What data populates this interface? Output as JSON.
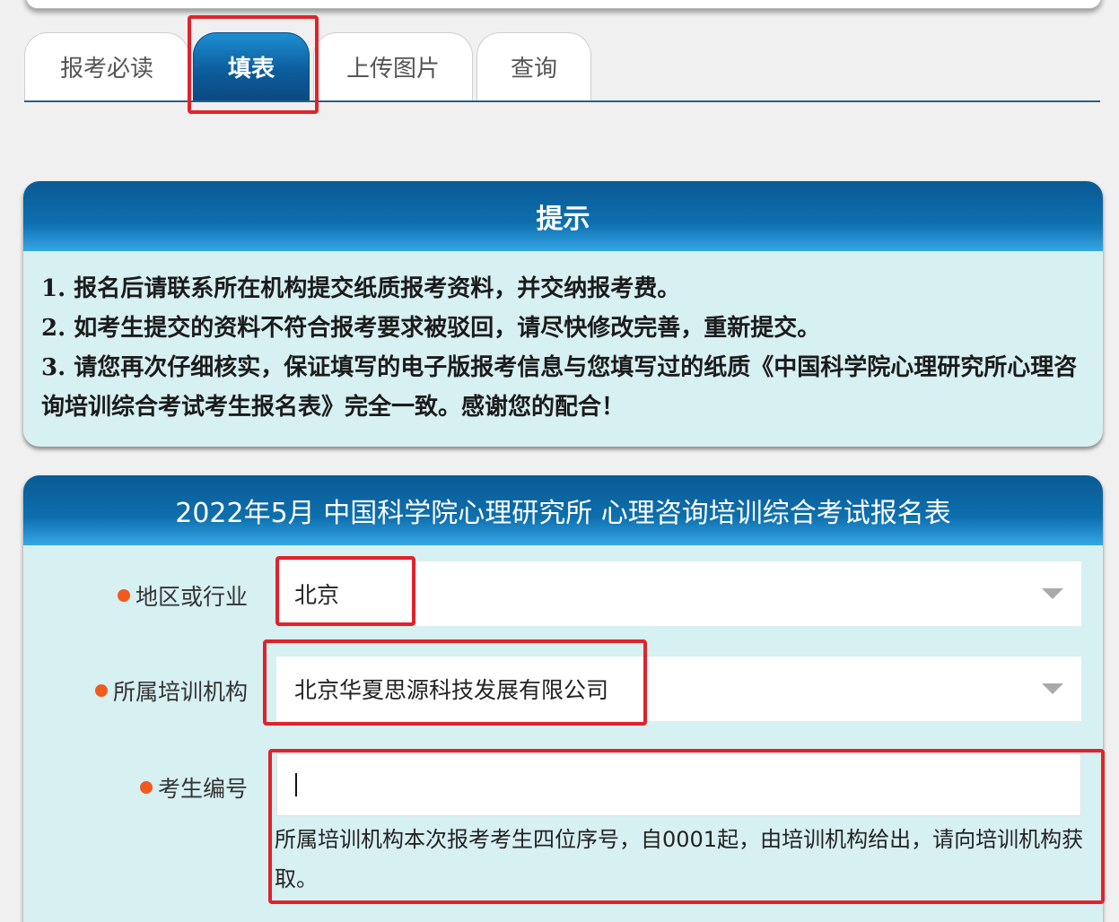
{
  "tabs": [
    {
      "label": "报考必读",
      "active": false
    },
    {
      "label": "填表",
      "active": true
    },
    {
      "label": "上传图片",
      "active": false
    },
    {
      "label": "查询",
      "active": false
    }
  ],
  "hint": {
    "title": "提示",
    "lines": [
      "1. 报名后请联系所在机构提交纸质报考资料，并交纳报考费。",
      "2. 如考生提交的资料不符合报考要求被驳回，请尽快修改完善，重新提交。",
      "3. 请您再次仔细核实，保证填写的电子版报考信息与您填写过的纸质《中国科学院心理研究所心理咨询培训综合考试考生报名表》完全一致。感谢您的配合！"
    ]
  },
  "form": {
    "title": "2022年5月 中国科学院心理研究所 心理咨询培训综合考试报名表",
    "fields": {
      "region": {
        "label": "地区或行业",
        "value": "北京"
      },
      "institution": {
        "label": "所属培训机构",
        "value": "北京华夏思源科技发展有限公司"
      },
      "candidate_no": {
        "label": "考生编号",
        "value": "",
        "helper": "所属培训机构本次报考考生四位序号，自0001起，由培训机构给出，请向培训机构获取。"
      }
    }
  },
  "colors": {
    "accent": "#0d5d9d",
    "panel_bg": "#d7f0f2",
    "required_dot": "#f05a1f",
    "highlight_box": "#e0232b"
  }
}
